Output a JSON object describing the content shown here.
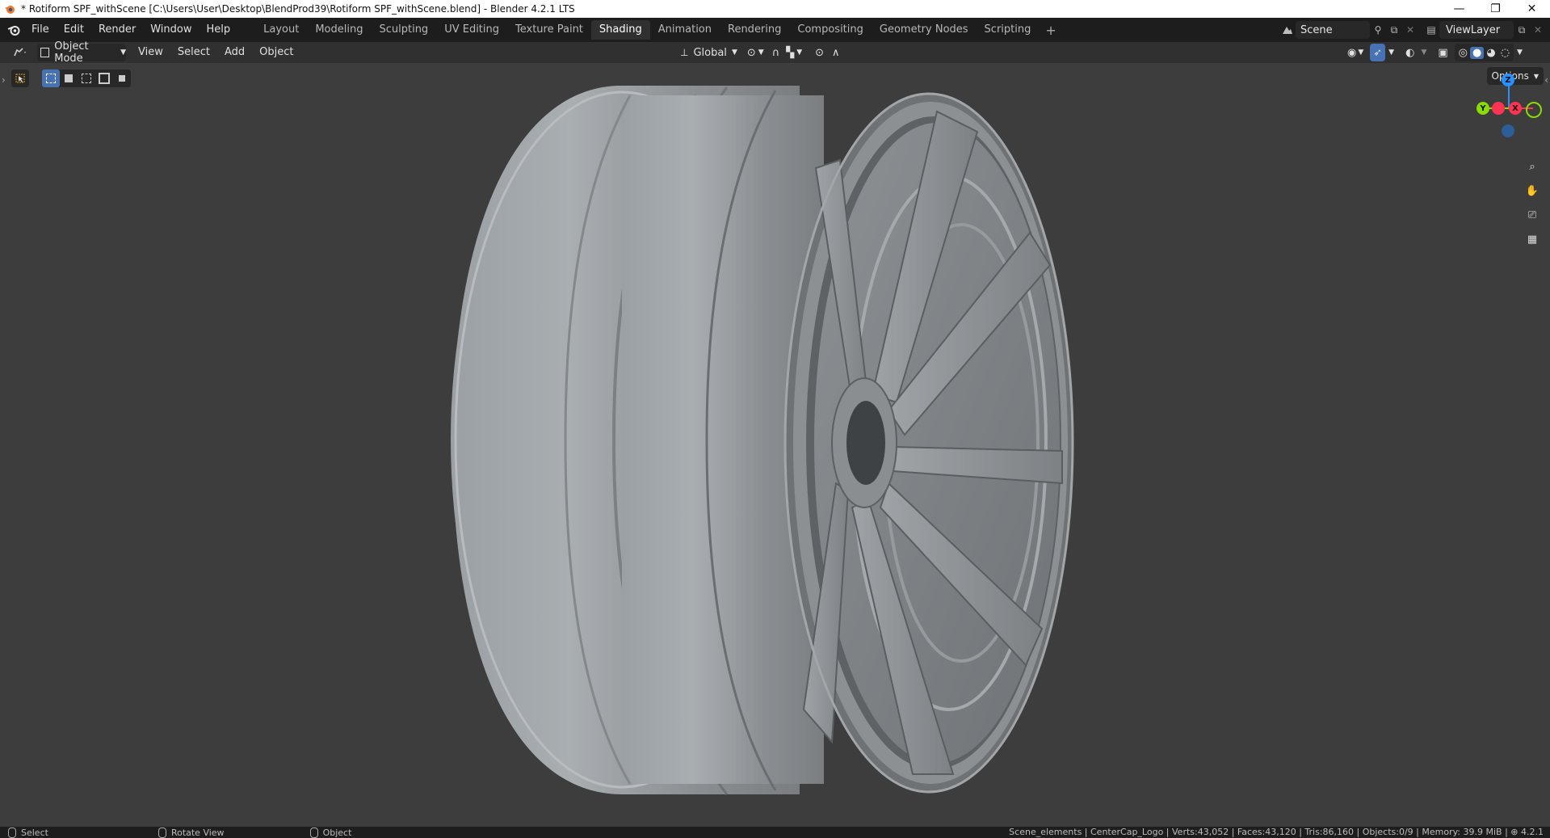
{
  "window": {
    "title": "* Rotiform SPF_withScene [C:\\Users\\User\\Desktop\\BlendProd39\\Rotiform SPF_withScene.blend] - Blender 4.2.1 LTS",
    "controls": {
      "minimize": "—",
      "maximize": "❐",
      "close": "✕"
    }
  },
  "menu": [
    "File",
    "Edit",
    "Render",
    "Window",
    "Help"
  ],
  "workspaces": [
    {
      "label": "Layout"
    },
    {
      "label": "Modeling"
    },
    {
      "label": "Sculpting"
    },
    {
      "label": "UV Editing"
    },
    {
      "label": "Texture Paint"
    },
    {
      "label": "Shading",
      "active": true
    },
    {
      "label": "Animation"
    },
    {
      "label": "Rendering"
    },
    {
      "label": "Compositing"
    },
    {
      "label": "Geometry Nodes"
    },
    {
      "label": "Scripting"
    }
  ],
  "workspace_add": "+",
  "scene": {
    "name": "Scene"
  },
  "view_layer": {
    "name": "ViewLayer"
  },
  "viewport_header": {
    "mode": "Object Mode",
    "menus": [
      "View",
      "Select",
      "Add",
      "Object"
    ],
    "transform_orientation": "Global"
  },
  "viewport": {
    "options_label": "Options",
    "gizmo": {
      "z": "Z",
      "y": "Y",
      "x": "X"
    },
    "tool_icons": [
      "zoom-icon",
      "pan-hand-icon",
      "camera-icon",
      "grid-icon"
    ]
  },
  "statusbar": {
    "hints": [
      "Select",
      "Rotate View",
      "Object"
    ],
    "stats": "Scene_elements | CenterCap_Logo | Verts:43,052 | Faces:43,120 | Tris:86,160 | Objects:0/9 | Memory: 39.9 MiB | ⊕ 4.2.1"
  },
  "colors": {
    "accent": "#4772b3",
    "axis_x": "#ff3352",
    "axis_y": "#8bdc00",
    "axis_z": "#2890ff",
    "viewport_bg": "#3d3d3d"
  }
}
